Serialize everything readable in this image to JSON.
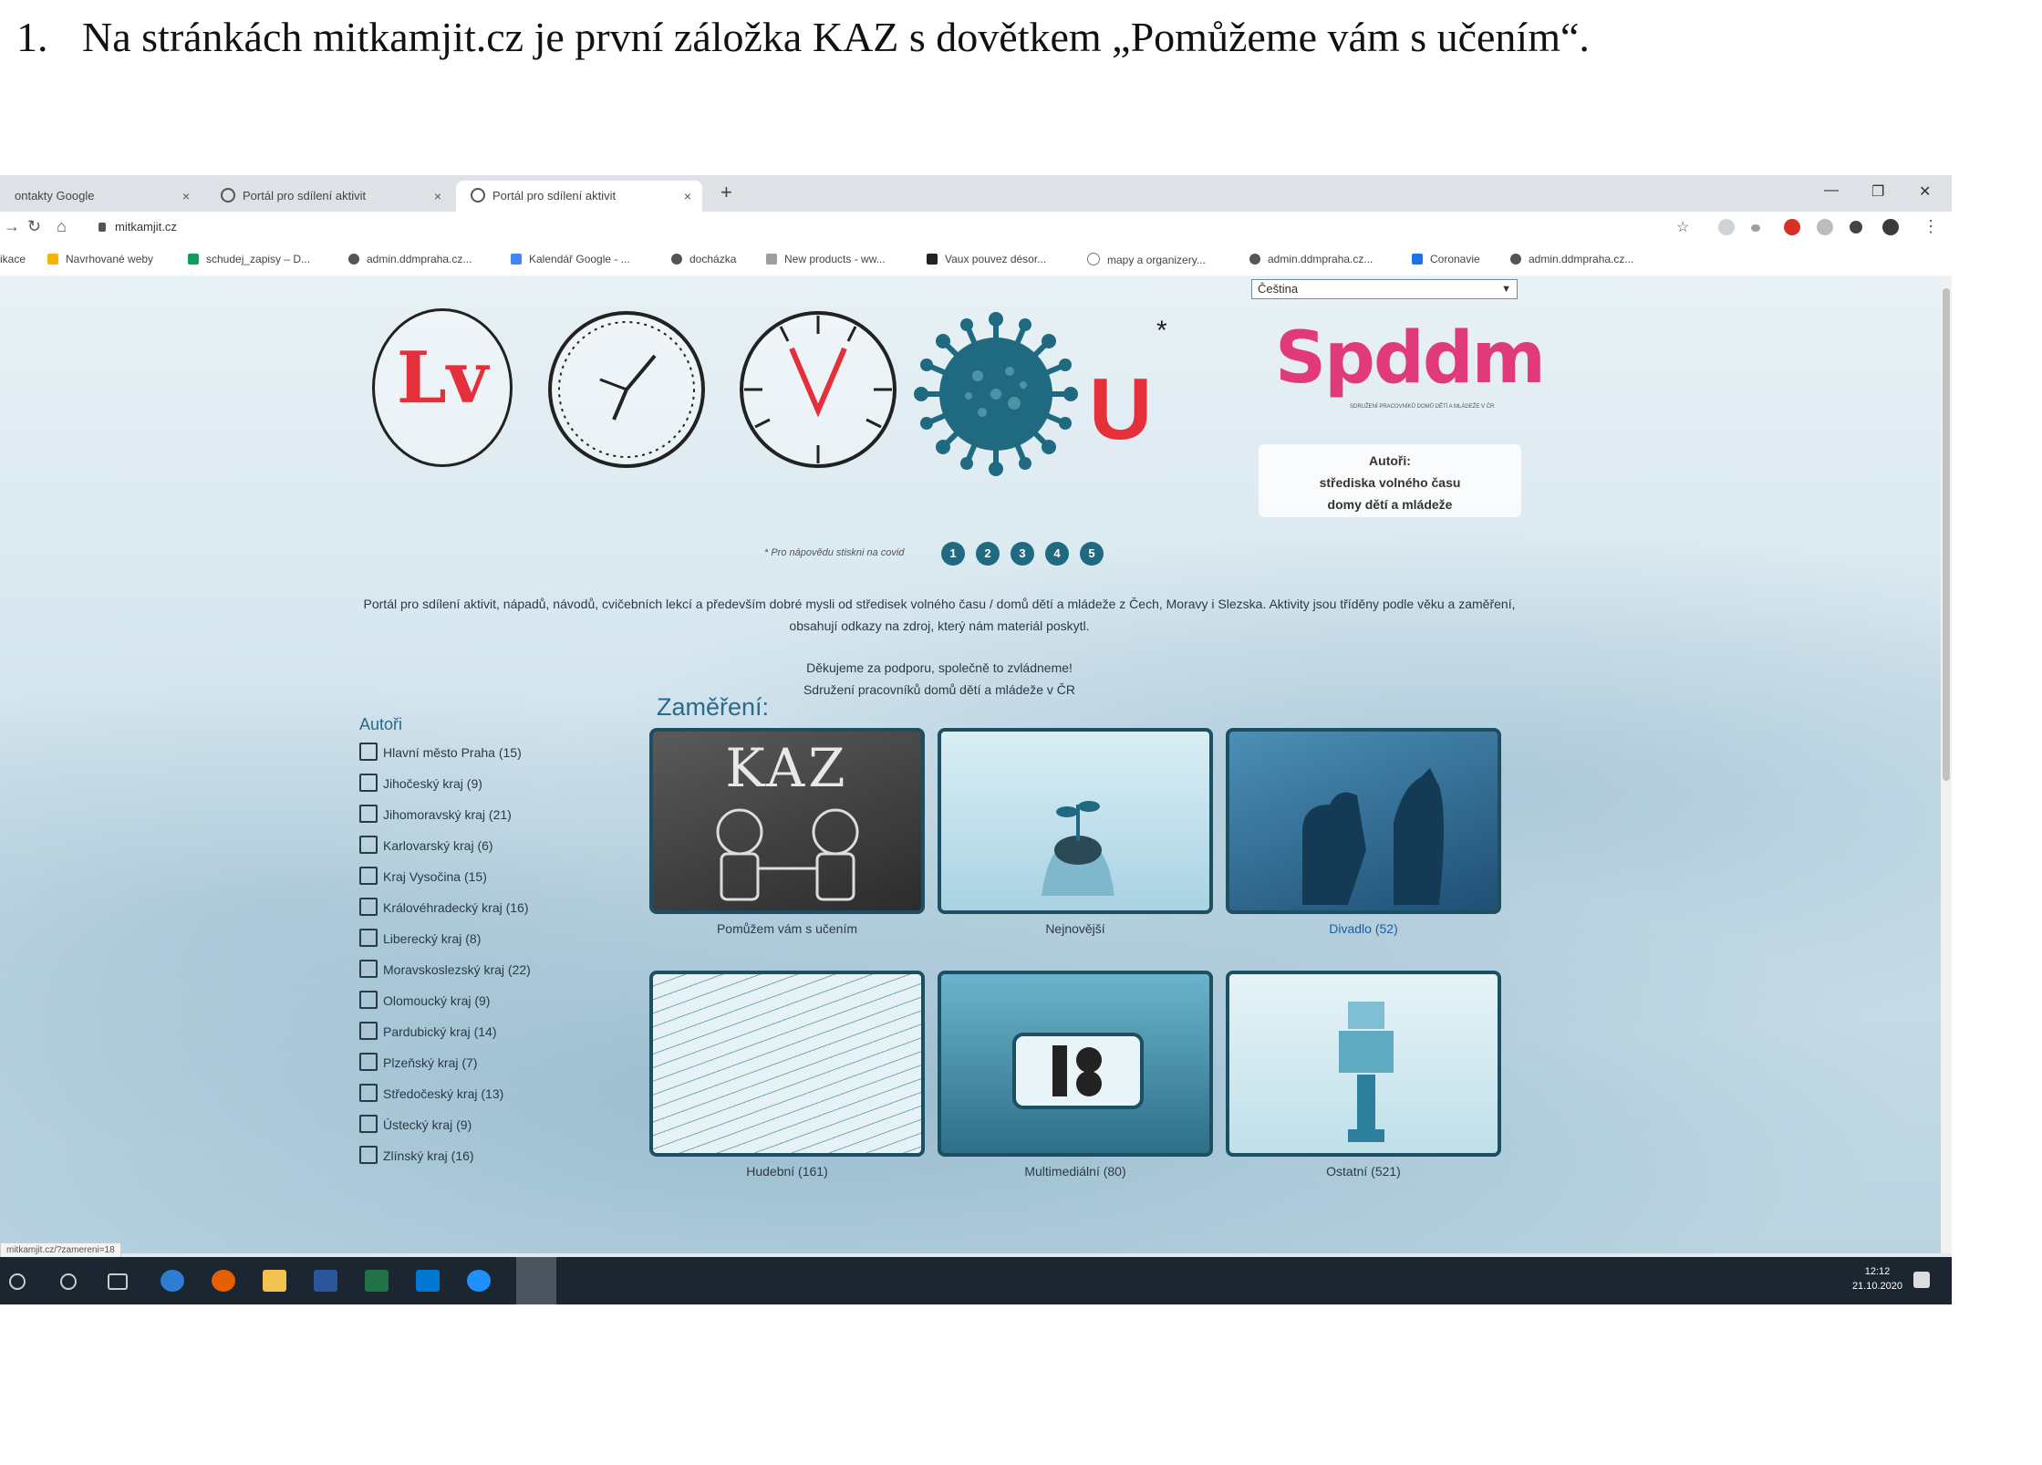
{
  "document": {
    "number": "1.",
    "text": "Na stránkách mitkamjit.cz je první záložka KAZ s dovětkem „Pomůžeme vám s učením“."
  },
  "browser": {
    "tabs": [
      {
        "label": "ontakty Google",
        "active": false
      },
      {
        "label": "Portál pro sdílení aktivit",
        "active": false
      },
      {
        "label": "Portál pro sdílení aktivit",
        "active": true
      }
    ],
    "url": "mitkamjit.cz",
    "bookmarks": [
      "ikace",
      "Navrhované weby",
      "schudej_zapisy – D...",
      "admin.ddmpraha.cz...",
      "Kalendář Google - ...",
      "docházka",
      "New products - ww...",
      "Vaux pouvez désor...",
      "mapy a organizery...",
      "admin.ddmpraha.cz...",
      "Coronavie",
      "admin.ddmpraha.cz..."
    ],
    "status_url": "mitkamjit.cz/?zamereni=18"
  },
  "site": {
    "language": "Čeština",
    "spddm_logo": "Spddm",
    "spddm_subtitle": "SDRUŽENÍ PRACOVNÍKŮ DOMŮ DĚTÍ A MLÁDEŽE V ČR",
    "authors_card": [
      "Autoři:",
      "střediska volného času",
      "domy dětí a mládeže"
    ],
    "covid_hint": "* Pro nápovědu stiskni na covid",
    "covid_buttons": [
      "1",
      "2",
      "3",
      "4",
      "5"
    ],
    "intro": "Portál pro sdílení aktivit, nápadů, návodů, cvičebních lekcí a především dobré mysli od středisek volného času / domů dětí a mládeže z Čech, Moravy i Slezska. Aktivity jsou tříděny podle věku a zaměření, obsahují odkazy na zdroj, který nám materiál poskytl.",
    "thanks_1": "Děkujeme za podporu, společně to zvládneme!",
    "thanks_2": "Sdružení pracovníků domů dětí a mládeže v ČR",
    "authors_title": "Autoři",
    "regions": [
      "Hlavní město Praha (15)",
      "Jihočeský kraj (9)",
      "Jihomoravský kraj (21)",
      "Karlovarský kraj (6)",
      "Kraj Vysočina (15)",
      "Královéhradecký kraj (16)",
      "Liberecký kraj (8)",
      "Moravskoslezský kraj (22)",
      "Olomoucký kraj (9)",
      "Pardubický kraj (14)",
      "Plzeňský kraj (7)",
      "Středočeský kraj (13)",
      "Ústecký kraj (9)",
      "Zlínský kraj (16)"
    ],
    "focus_title": "Zaměření:",
    "tiles": [
      {
        "label": "Pomůžem vám s učením",
        "image_text": "KAZ"
      },
      {
        "label": "Nejnovější"
      },
      {
        "label": "Divadlo (52)",
        "highlight": true
      },
      {
        "label": "Hudební (161)"
      },
      {
        "label": "Multimediální (80)"
      },
      {
        "label": "Ostatní (521)"
      }
    ]
  },
  "taskbar": {
    "time": "12:12",
    "date": "21.10.2020"
  },
  "colors": {
    "logo_red": "#e3303a",
    "virus_teal": "#1f6a80",
    "spddm_pink": "#e03a7a",
    "tile_border": "#1d4f63"
  }
}
